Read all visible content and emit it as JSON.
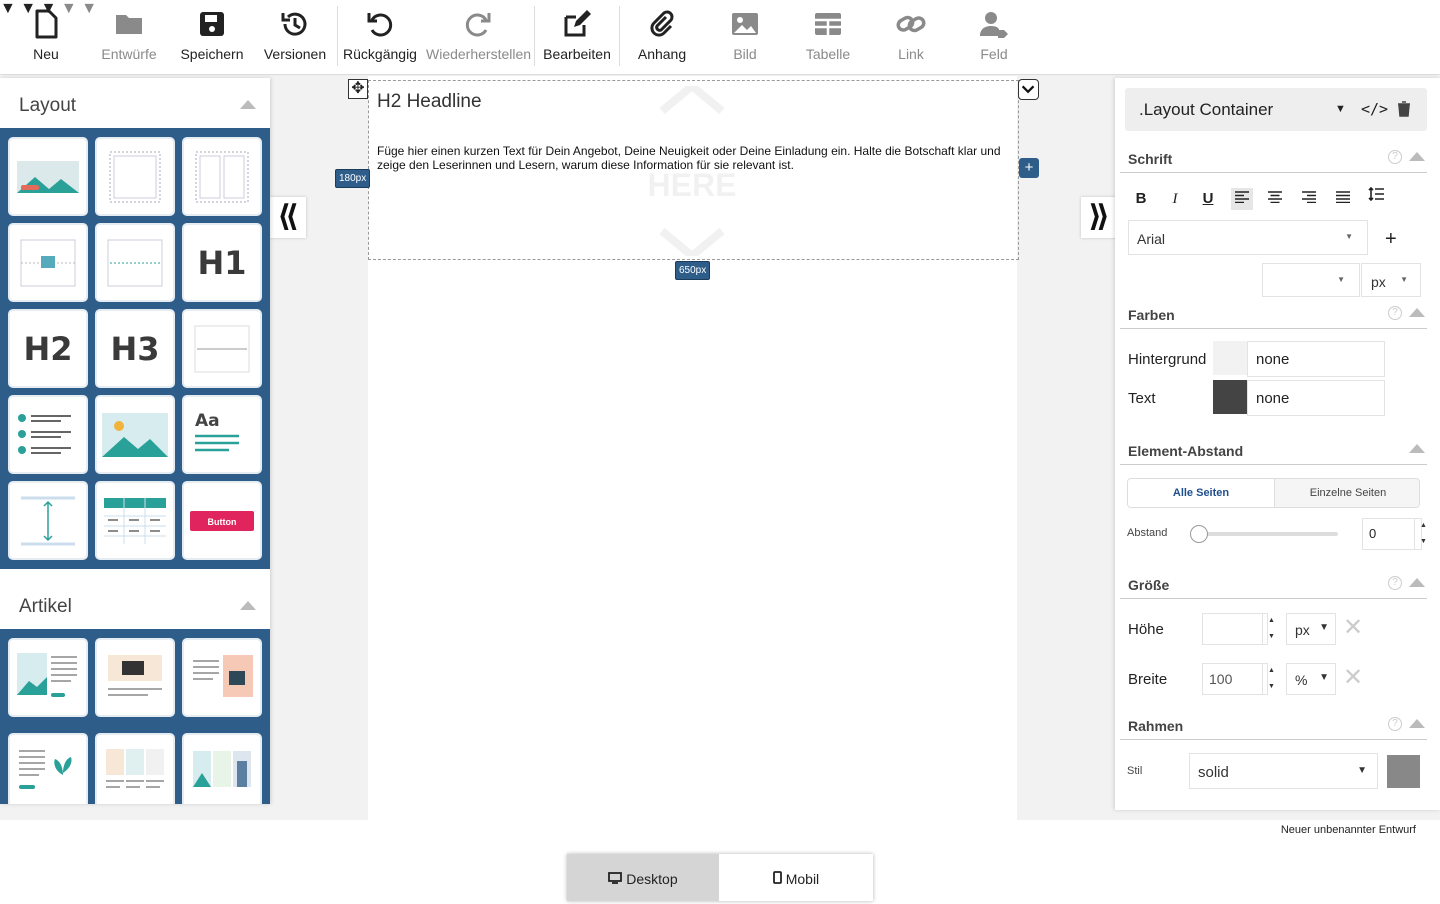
{
  "toolbar": {
    "items": [
      {
        "label": "Neu",
        "icon": "file-icon"
      },
      {
        "label": "Entwürfe",
        "icon": "folder-icon"
      },
      {
        "label": "Speichern",
        "icon": "save-icon"
      },
      {
        "label": "Versionen",
        "icon": "history-icon"
      },
      {
        "label": "Rückgängig",
        "icon": "undo-icon"
      },
      {
        "label": "Wiederherstellen",
        "icon": "redo-icon"
      },
      {
        "label": "Bearbeiten",
        "icon": "edit-icon"
      },
      {
        "label": "Anhang",
        "icon": "paperclip-icon"
      },
      {
        "label": "Bild",
        "icon": "image-icon"
      },
      {
        "label": "Tabelle",
        "icon": "table-icon"
      },
      {
        "label": "Link",
        "icon": "link-icon"
      },
      {
        "label": "Feld",
        "icon": "user-field-icon"
      }
    ]
  },
  "left_panel": {
    "layout_title": "Layout",
    "layout_tiles": [
      "hero-image",
      "container",
      "two-column",
      "image-divider",
      "dotted-divider",
      "H1",
      "H2",
      "H3",
      "line-divider",
      "checklist",
      "image",
      "text-block",
      "spacer",
      "table",
      "button"
    ],
    "button_tile_label": "Button",
    "articles_title": "Artikel"
  },
  "canvas": {
    "headline": "H2 Headline",
    "body": "Füge hier einen kurzen Text für Dein Angebot, Deine Neuigkeit oder Deine Einladung ein. Halte die Botschaft klar und zeige den Leserinnen und Lesern, warum diese Information für sie relevant ist.",
    "height_badge": "180px",
    "width_badge": "650px",
    "watermark": "HERE"
  },
  "right_panel": {
    "element_name": ".Layout Container",
    "font_section": "Schrift",
    "font_family": "Arial",
    "font_size": "",
    "font_unit": "px",
    "colors_section": "Farben",
    "background_label": "Hintergrund",
    "background_value": "none",
    "background_swatch": "#f2f2f2",
    "text_label": "Text",
    "text_value": "none",
    "text_swatch": "#444444",
    "spacing_section": "Element-Abstand",
    "tab_all": "Alle Seiten",
    "tab_single": "Einzelne Seiten",
    "spacing_label": "Abstand",
    "spacing_value": "0",
    "size_section": "Größe",
    "height_label": "Höhe",
    "height_value": "",
    "height_unit": "px",
    "width_label": "Breite",
    "width_value": "100",
    "width_unit": "%",
    "border_section": "Rahmen",
    "style_label": "Stil",
    "style_value": "solid",
    "border_swatch": "#888888"
  },
  "status_text": "Neuer unbenannter Entwurf",
  "device_bar": {
    "desktop": "Desktop",
    "mobile": "Mobil"
  },
  "colors": {
    "accent": "#2f5d8a",
    "teal": "#2aa198",
    "red": "#e0245e"
  }
}
